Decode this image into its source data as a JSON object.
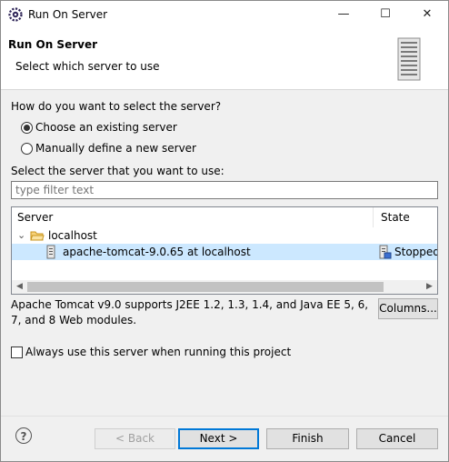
{
  "window": {
    "title": "Run On Server",
    "app_icon": "eclipse-gear-icon",
    "minimize_glyph": "—",
    "maximize_glyph": "☐",
    "close_glyph": "✕"
  },
  "header": {
    "title": "Run On Server",
    "subtitle": "Select which server to use",
    "graphic": "server-tower-icon"
  },
  "selection": {
    "question": "How do you want to select the server?",
    "options": [
      {
        "label": "Choose an existing server",
        "selected": true
      },
      {
        "label": "Manually define a new server",
        "selected": false
      }
    ]
  },
  "server_list": {
    "prompt": "Select the server that you want to use:",
    "filter_placeholder": "type filter text",
    "columns": [
      "Server",
      "State"
    ],
    "folder": {
      "expander": "⌄",
      "label": "localhost"
    },
    "servers": [
      {
        "name": "apache-tomcat-9.0.65 at localhost",
        "state": "Stopped",
        "selected": true
      }
    ]
  },
  "description": "Apache Tomcat v9.0 supports J2EE 1.2, 1.3, 1.4, and Java EE 5, 6, 7, and 8 Web modules.",
  "columns_button": "Columns...",
  "always_use": {
    "label": "Always use this server when running this project",
    "checked": false
  },
  "footer": {
    "help": "?",
    "back": "< Back",
    "next": "Next >",
    "finish": "Finish",
    "cancel": "Cancel"
  },
  "colors": {
    "selection_bg": "#cce8ff",
    "default_button_border": "#0078d7",
    "folder_yellow": "#e8b43a"
  }
}
